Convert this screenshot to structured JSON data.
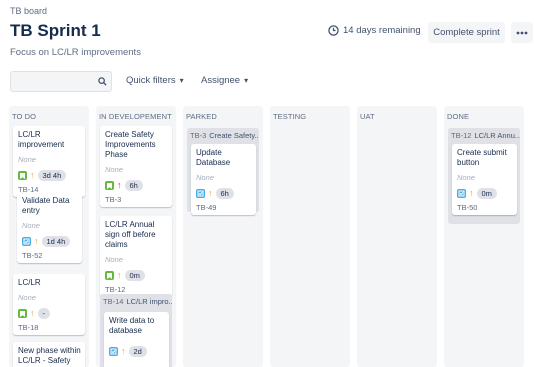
{
  "header": {
    "breadcrumb": "TB board",
    "title": "TB Sprint 1",
    "subtitle": "Focus on LC/LR improvements",
    "remaining": "14 days remaining",
    "complete_label": "Complete sprint",
    "more_label": "•••"
  },
  "toolbar": {
    "search_value": "",
    "quick_filters": "Quick filters",
    "assignee": "Assignee"
  },
  "colors": {
    "story": "#63ba3c",
    "task": "#4bade8",
    "priority_high": "#ff5630",
    "priority_medium": "#ff991f",
    "priority_highest": "#de350b"
  },
  "columns": [
    {
      "name": "TO DO"
    },
    {
      "name": "IN DEVELOPEMENT"
    },
    {
      "name": "PARKED"
    },
    {
      "name": "TESTING"
    },
    {
      "name": "UAT"
    },
    {
      "name": "DONE"
    }
  ],
  "cards": {
    "todo_1": {
      "title": "LC/LR improvement",
      "epic": "None",
      "estimate": "3d 4h",
      "key": "TB-14",
      "type": "story-icon",
      "priority": "priority-medium-icon"
    },
    "todo_2": {
      "title": "Validate Data entry",
      "epic": "None",
      "estimate": "1d 4h",
      "key": "TB-52",
      "type": "task-icon",
      "priority": "priority-medium-icon"
    },
    "todo_3": {
      "title": "LC/LR",
      "epic": "None",
      "estimate": "-",
      "key": "TB-18",
      "type": "story-icon",
      "priority": "priority-medium-icon"
    },
    "todo_4": {
      "title": "New phase within LC/LR - Safety"
    },
    "dev_1": {
      "title": "Create Safety Improvements Phase",
      "epic": "None",
      "estimate": "6h",
      "key": "TB-3",
      "type": "story-icon",
      "priority": "priority-high-icon"
    },
    "dev_2": {
      "title": "LC/LR Annual sign off before claims",
      "epic": "None",
      "estimate": "0m",
      "key": "TB-12",
      "type": "story-icon",
      "priority": "priority-medium-icon"
    },
    "dev_parent": {
      "key": "TB-14",
      "title": "LC/LR impro..."
    },
    "dev_3": {
      "title": "Write data to database",
      "estimate": "2d"
    },
    "parked_parent": {
      "key": "TB-3",
      "title": "Create Safety..."
    },
    "parked_1": {
      "title": "Update Database",
      "epic": "None",
      "estimate": "6h",
      "key": "TB-49",
      "type": "task-icon",
      "priority": "priority-medium-icon"
    },
    "done_parent": {
      "key": "TB-12",
      "title": "LC/LR Annu..."
    },
    "done_1": {
      "title": "Create submit button",
      "epic": "None",
      "estimate": "0m",
      "key": "TB-50",
      "type": "task-icon",
      "priority": "priority-medium-icon"
    }
  }
}
